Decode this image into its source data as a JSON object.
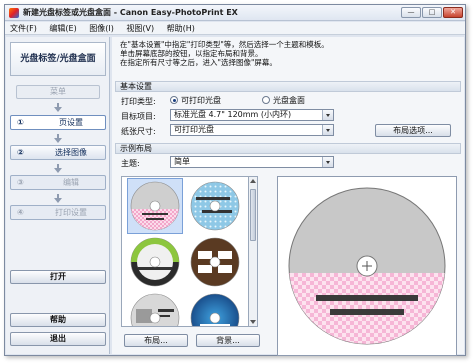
{
  "window": {
    "title": "新建光盘标签或光盘盒面 - Canon Easy-PhotoPrint EX",
    "minimize": "—",
    "maximize": "□",
    "close": "✕"
  },
  "menu": [
    "文件(F)",
    "编辑(E)",
    "图像(I)",
    "视图(V)",
    "帮助(H)"
  ],
  "sidebar": {
    "title": "光盘标签/光盘盒面",
    "menu_button": "菜单",
    "steps": [
      {
        "num": "①",
        "label": "页设置"
      },
      {
        "num": "②",
        "label": "选择图像"
      },
      {
        "num": "③",
        "label": "编辑"
      },
      {
        "num": "④",
        "label": "打印设置"
      }
    ],
    "open_button": "打开",
    "help_button": "帮助",
    "exit_button": "退出"
  },
  "main": {
    "instructions": [
      "在\"基本设置\"中指定\"打印类型\"等，然后选择一个主题和模板。",
      "单击屏幕底部的按钮，以指定布局和背景。",
      "在指定所有尺寸等之后，进入\"选择图像\"屏幕。"
    ],
    "basic_settings": {
      "header": "基本设置",
      "print_type_label": "打印类型:",
      "print_type_options": [
        "可打印光盘",
        "光盘盒面"
      ],
      "print_type_selected": 0,
      "target_label": "目标项目:",
      "target_value": "标准光盘 4.7\" 120mm (小内环)",
      "paper_size_label": "纸张尺寸:",
      "paper_size_value": "可打印光盘",
      "layout_options_button": "布局选项..."
    },
    "sample_layout": {
      "header": "示例布局",
      "theme_label": "主题:",
      "theme_value": "简单",
      "layout_button": "布局...",
      "background_button": "背景..."
    }
  },
  "colors": {
    "accent": "#1a3f80",
    "disc_gray": "#c8c8c8",
    "pink": "#f6b6d6",
    "text_bar": "#3a3a3a"
  }
}
